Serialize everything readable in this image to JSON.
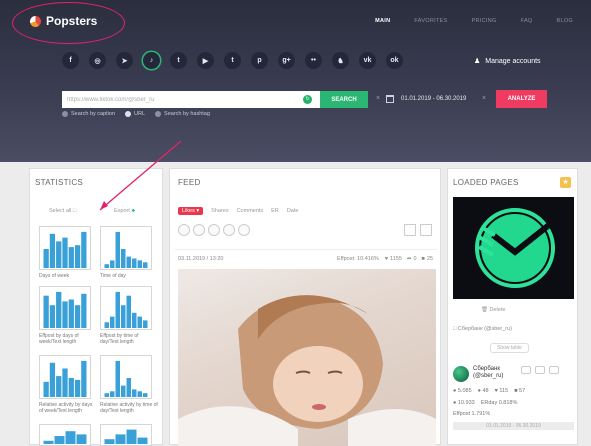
{
  "app": {
    "name": "Popsters"
  },
  "nav": {
    "items": [
      "MAIN",
      "FAVORITES",
      "PRICING",
      "FAQ",
      "BLOG"
    ]
  },
  "socials": [
    {
      "icon": "facebook-icon",
      "glyph": "f"
    },
    {
      "icon": "instagram-icon",
      "glyph": "◎"
    },
    {
      "icon": "telegram-icon",
      "glyph": "➤"
    },
    {
      "icon": "tiktok-icon",
      "glyph": "♪"
    },
    {
      "icon": "twitter-icon",
      "glyph": "t"
    },
    {
      "icon": "youtube-icon",
      "glyph": "▶"
    },
    {
      "icon": "tumblr-icon",
      "glyph": "t"
    },
    {
      "icon": "pinterest-icon",
      "glyph": "p"
    },
    {
      "icon": "google-plus-icon",
      "glyph": "g+"
    },
    {
      "icon": "flickr-icon",
      "glyph": "••"
    },
    {
      "icon": "snapchat-icon",
      "glyph": "♞"
    },
    {
      "icon": "vk-icon",
      "glyph": "vk"
    },
    {
      "icon": "odnoklassniki-icon",
      "glyph": "ok"
    }
  ],
  "manage": {
    "label": "Manage accounts"
  },
  "search": {
    "value": "https://www.tiktok.com/@sber_ru",
    "button": "SEARCH",
    "x": "×"
  },
  "dates": {
    "range": "01.01.2019 - 06.30.2019",
    "x": "×"
  },
  "analyze": {
    "label": "ANALYZE"
  },
  "search_options": [
    {
      "label": "Search by caption",
      "checked": false
    },
    {
      "label": "URL",
      "checked": true
    },
    {
      "label": "Search by hashtag",
      "checked": false
    }
  ],
  "statistics": {
    "title": "STATISTICS",
    "select_all": "Select all",
    "export": "Export",
    "charts": [
      {
        "label": "Days of week",
        "bars": [
          0.5,
          0.9,
          0.7,
          0.8,
          0.55,
          0.6,
          0.95
        ]
      },
      {
        "label": "Time of day",
        "bars": [
          0.1,
          0.2,
          0.95,
          0.5,
          0.3,
          0.25,
          0.2,
          0.15
        ]
      },
      {
        "label": "Effpost by days of week/Text length",
        "bars": [
          0.85,
          0.6,
          0.95,
          0.7,
          0.75,
          0.6,
          0.9
        ]
      },
      {
        "label": "Effpost by time of day/Text length",
        "bars": [
          0.15,
          0.3,
          0.95,
          0.6,
          0.85,
          0.4,
          0.3,
          0.2
        ]
      },
      {
        "label": "Relative activity by days of week/Text length",
        "bars": [
          0.4,
          0.9,
          0.55,
          0.75,
          0.5,
          0.45,
          0.95
        ]
      },
      {
        "label": "Relative activity by time of day/Text length",
        "bars": [
          0.1,
          0.15,
          0.95,
          0.3,
          0.5,
          0.2,
          0.15,
          0.1
        ]
      },
      {
        "label": "",
        "bars": [
          0.2,
          0.5,
          0.8,
          0.6
        ]
      },
      {
        "label": "",
        "bars": [
          0.3,
          0.6,
          0.9,
          0.4
        ]
      }
    ]
  },
  "feed": {
    "title": "FEED",
    "tabs": [
      "Likes",
      "Shares",
      "Comments",
      "ER",
      "Date"
    ],
    "post": {
      "datetime": "03.11.2019 / 13:20",
      "effpost": "Effpost: 10.416%",
      "likes": "1155",
      "shares": "0",
      "comments": "25"
    }
  },
  "loaded": {
    "title": "LOADED PAGES",
    "delete": "Delete",
    "account": "Сбербанк (@sber_ru)",
    "show_table": "Show table",
    "profile_name": "Сбербанк (@sber_ru)",
    "stats": [
      [
        "5.085",
        "48",
        "115",
        "57"
      ],
      [
        "10.933",
        "ERday 0.818%"
      ],
      [
        "Effpost 1.791%"
      ]
    ],
    "range": "01.01.2019 - 06.30.2019"
  },
  "colors": {
    "accent": "#ef3b62",
    "green": "#2bb673",
    "bar": "#3aa0d8"
  }
}
